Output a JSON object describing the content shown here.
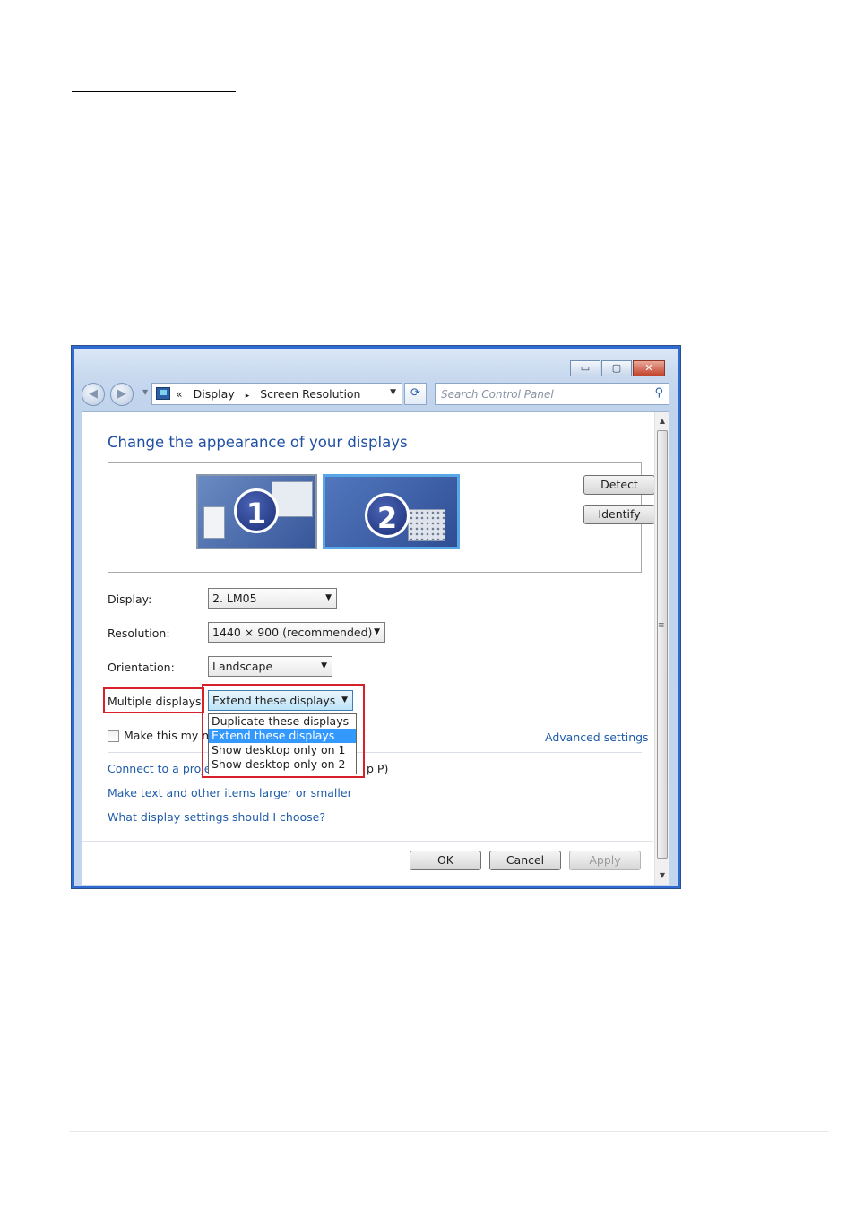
{
  "window": {
    "caption_buttons": {
      "minimize": "▭",
      "maximize": "▢",
      "close": "✕"
    },
    "nav": {
      "back_icon": "back-arrow-icon",
      "forward_icon": "forward-arrow-icon",
      "breadcrumb_prefix": "«",
      "breadcrumb": [
        "Display",
        "Screen Resolution"
      ],
      "breadcrumb_separator": "▸",
      "refresh_glyph": "⟳",
      "search_placeholder": "Search Control Panel",
      "search_glyph": "⚲"
    }
  },
  "main": {
    "title": "Change the appearance of your displays",
    "monitors": [
      {
        "number": "1"
      },
      {
        "number": "2"
      }
    ],
    "detect_label": "Detect",
    "identify_label": "Identify",
    "display": {
      "label": "Display:",
      "value": "2. LM05"
    },
    "resolution": {
      "label": "Resolution:",
      "value": "1440 × 900 (recommended)"
    },
    "orientation": {
      "label": "Orientation:",
      "value": "Landscape"
    },
    "multiple_displays": {
      "label": "Multiple displays:",
      "value": "Extend these displays",
      "options": [
        "Duplicate these displays",
        "Extend these displays",
        "Show desktop only on 1",
        "Show desktop only on 2"
      ],
      "selected_index": 1
    },
    "main_display_checkbox_visible": "Make this my m",
    "advanced_settings": "Advanced settings",
    "links": {
      "projector_visible_start": "Connect to a proje",
      "projector_visible_end": "p P)",
      "text_size": "Make text and other items larger or smaller",
      "help": "What display settings should I choose?"
    }
  },
  "footer": {
    "ok_label": "OK",
    "cancel_label": "Cancel",
    "apply_label": "Apply"
  },
  "colors": {
    "frame": "#2f6bd1",
    "link": "#1f5ca8",
    "title": "#1f4fa3",
    "highlight": "#d6202a",
    "selection": "#3399ff"
  }
}
